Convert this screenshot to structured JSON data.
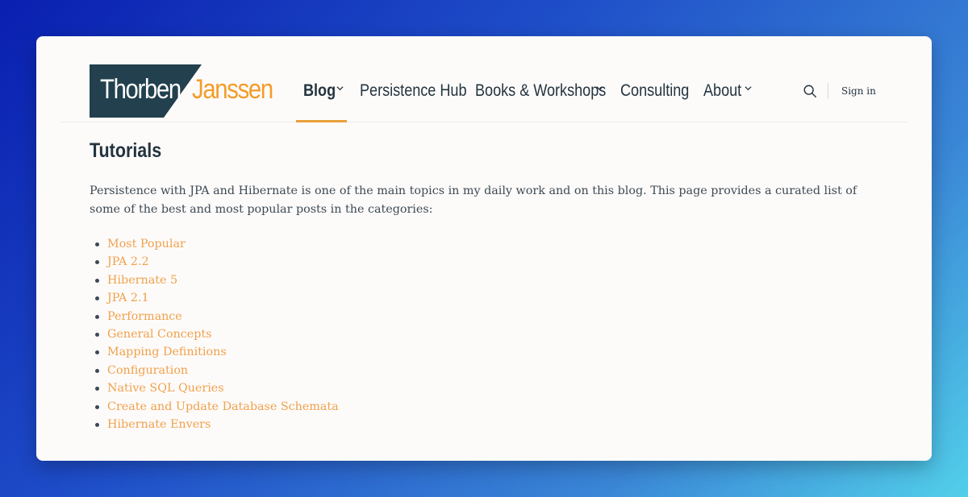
{
  "brand": {
    "first": "Thorben",
    "last": "Janssen",
    "colors": {
      "dark": "#22404e",
      "accent": "#f39c2a"
    }
  },
  "nav": {
    "items": [
      {
        "label": "Blog",
        "active": true,
        "dropdown": true
      },
      {
        "label": "Persistence Hub",
        "active": false,
        "dropdown": false
      },
      {
        "label": "Books & Workshops",
        "active": false,
        "dropdown": true
      },
      {
        "label": "Consulting",
        "active": false,
        "dropdown": false
      },
      {
        "label": "About",
        "active": false,
        "dropdown": true
      }
    ],
    "search_icon": "search-icon",
    "sign_in": "Sign in"
  },
  "page": {
    "title": "Tutorials",
    "intro": "Persistence with JPA and Hibernate is one of the main topics in my daily work and on this blog. This page provides a curated list of some of the best and most popular posts in the categories:",
    "topics": [
      "Most Popular",
      "JPA 2.2",
      "Hibernate 5",
      "JPA 2.1",
      "Performance",
      "General Concepts",
      "Mapping Definitions",
      "Configuration",
      "Native SQL Queries",
      "Create and Update Database Schemata",
      "Hibernate Envers"
    ]
  },
  "colors": {
    "text": "#23343f",
    "link": "#f0a14c",
    "active_underline": "#e8a03a",
    "card_bg": "#fdfbfa"
  }
}
